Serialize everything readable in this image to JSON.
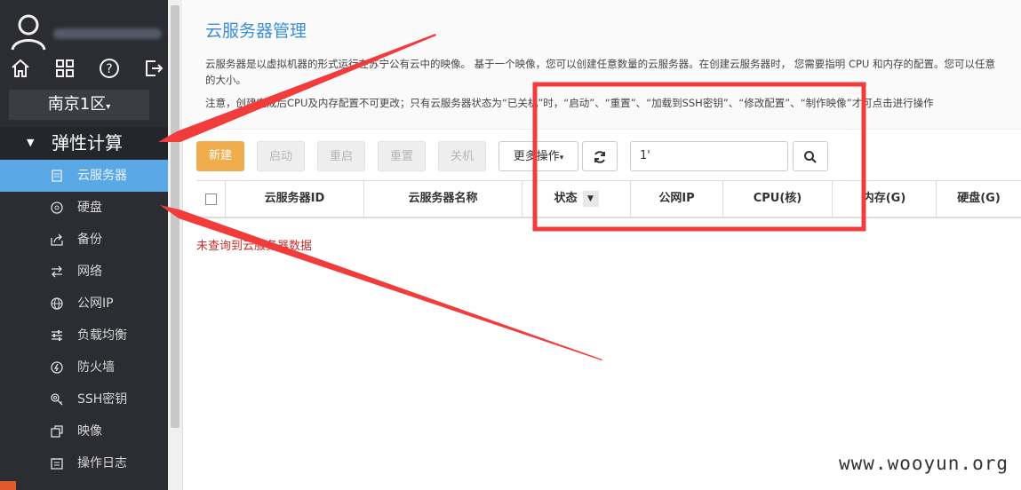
{
  "sidebar": {
    "region": "南京1区",
    "group": "弹性计算",
    "items": [
      {
        "label": "云服务器",
        "icon": "server-icon",
        "active": true
      },
      {
        "label": "硬盘",
        "icon": "disk-icon"
      },
      {
        "label": "备份",
        "icon": "backup-icon"
      },
      {
        "label": "网络",
        "icon": "network-icon"
      },
      {
        "label": "公网IP",
        "icon": "globe-icon"
      },
      {
        "label": "负载均衡",
        "icon": "sliders-icon"
      },
      {
        "label": "防火墙",
        "icon": "firewall-icon"
      },
      {
        "label": "SSH密钥",
        "icon": "key-icon"
      },
      {
        "label": "映像",
        "icon": "image-icon"
      },
      {
        "label": "操作日志",
        "icon": "log-icon"
      }
    ]
  },
  "main": {
    "title": "云服务器管理",
    "description": "云服务器是以虚拟机器的形式运行在苏宁公有云中的映像。 基于一个映像，您可以创建任意数量的云服务器。在创建云服务器时， 您需要指明 CPU 和内存的配置。您可以任意",
    "description_tail": "的大小。",
    "note": "注意，创建完成后CPU及内存配置不可更改；只有云服务器状态为“已关机”时，“启动”、“重置”、“加载到SSH密钥”、“修改配置”、“制作映像”才可点击进行操作",
    "toolbar": {
      "new": "新建",
      "start": "启动",
      "restart": "重启",
      "reset": "重置",
      "shutdown": "关机",
      "more": "更多操作"
    },
    "search_value": "1'",
    "columns": [
      "云服务器ID",
      "云服务器名称",
      "状态",
      "公网IP",
      "CPU(核)",
      "内存(G)",
      "硬盘(G)"
    ],
    "empty_message": "未查询到云服务器数据"
  },
  "watermark": "www.wooyun.org",
  "colors": {
    "accent": "#3b8ed8",
    "active": "#5aa9e6",
    "primary_button": "#f0ad4e",
    "annotation": "#f23c3c",
    "error": "#c9302c"
  }
}
